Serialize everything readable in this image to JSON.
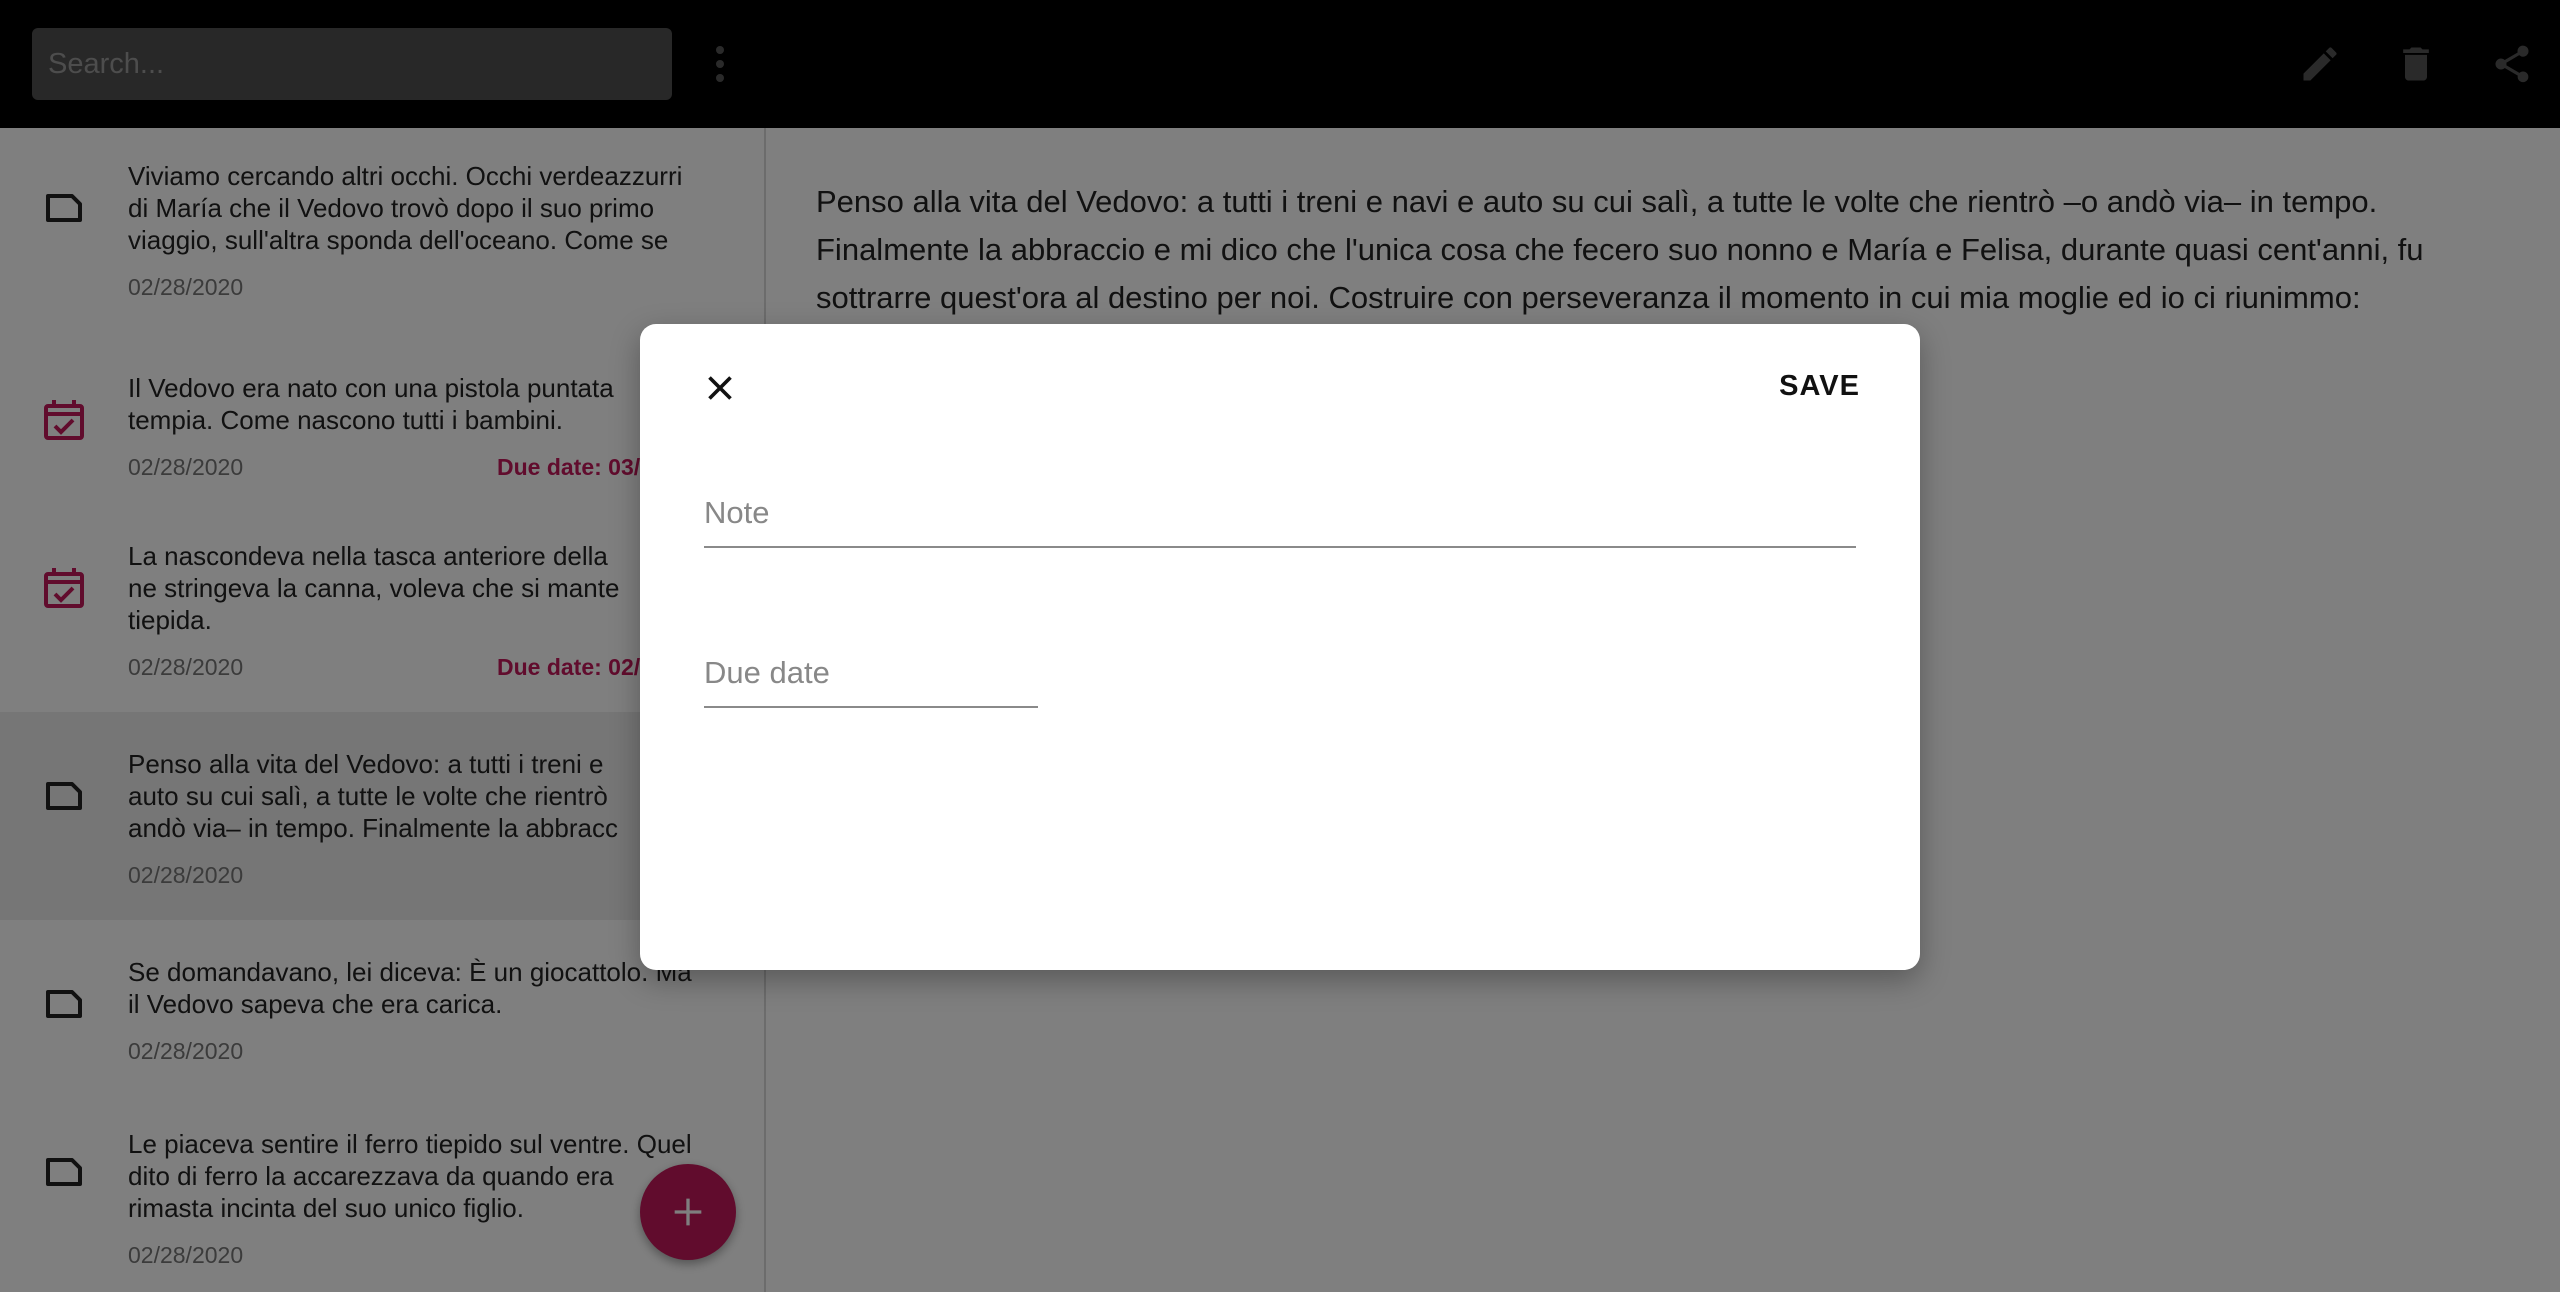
{
  "topbar": {
    "search_placeholder": "Search...",
    "menu_icon": "more-vert-icon",
    "edit_icon": "pencil-icon",
    "delete_icon": "trash-icon",
    "share_icon": "share-icon"
  },
  "notes": [
    {
      "type": "note",
      "text": "Viviamo cercando altri occhi. Occhi verdeazzurri\ndi María che il Vedovo trovò dopo il suo primo\nviaggio, sull'altra sponda dell'oceano. Come se",
      "date": "02/28/2020",
      "due": ""
    },
    {
      "type": "task",
      "text": "Il Vedovo era nato con una pistola puntata\ntempia. Come nascono tutti i bambini.",
      "date": "02/28/2020",
      "due": "Due date: 03/"
    },
    {
      "type": "task",
      "text": "La nascondeva nella tasca anteriore della\nne stringeva la canna, voleva che si mante\ntiepida.",
      "date": "02/28/2020",
      "due": "Due date: 02/"
    },
    {
      "type": "note",
      "text": "Penso alla vita del Vedovo: a tutti i treni e\nauto su cui salì, a tutte le volte che rientrò\nandò via– in tempo. Finalmente la abbracc",
      "date": "02/28/2020",
      "due": ""
    },
    {
      "type": "note",
      "text": "Se domandavano, lei diceva: È un giocattolo. Ma\nil Vedovo sapeva che era carica.",
      "date": "02/28/2020",
      "due": ""
    },
    {
      "type": "note",
      "text": "Le piaceva sentire il ferro tiepido sul ventre. Quel\ndito di ferro la accarezzava da quando era\nrimasta incinta del suo unico figlio.",
      "date": "02/28/2020",
      "due": ""
    }
  ],
  "content": {
    "text": "Penso alla vita del Vedovo: a tutti i treni e navi e auto su cui salì, a tutte le volte che rientrò –o andò via– in tempo. Finalmente la abbraccio e mi dico che l'unica cosa che fecero suo nonno e María e Felisa, durante quasi cent'anni, fu sottrarre quest'ora al destino per noi. Costruire con perseveranza il momento in cui mia moglie ed io ci riunimmo:"
  },
  "fab": {
    "icon": "plus-icon"
  },
  "dialog": {
    "close_icon": "close-icon",
    "save_label": "SAVE",
    "note_placeholder": "Note",
    "note_value": "",
    "due_placeholder": "Due date",
    "due_value": ""
  },
  "colors": {
    "accent": "#c2185b",
    "topbar": "#000000",
    "scrim": "rgba(0,0,0,0.5)"
  }
}
